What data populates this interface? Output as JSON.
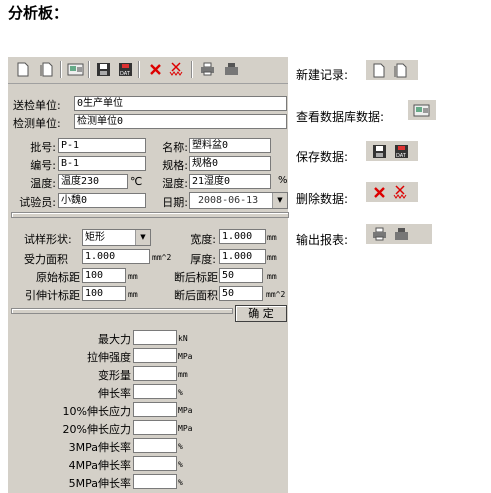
{
  "page_title": "分析板：",
  "top_form": {
    "sender_label": "送检单位:",
    "sender_value": "0生产单位",
    "tester_label": "检测单位:",
    "tester_value": "检测单位0"
  },
  "sample": {
    "batch_label": "批号:",
    "batch_value": "P-1",
    "name_label": "名称:",
    "name_value": "塑料盆0",
    "code_label": "编号:",
    "code_value": "B-1",
    "spec_label": "规格:",
    "spec_value": "规格0",
    "temp_label": "温度:",
    "temp_value": "温度230",
    "temp_unit": "℃",
    "humidity_label": "湿度:",
    "humidity_value": "21湿度0",
    "humidity_unit": "%",
    "operator_label": "试验员:",
    "operator_value": "小魏0",
    "date_label": "日期:",
    "date_value": "2008-06-13"
  },
  "geometry": {
    "shape_label": "试样形状:",
    "shape_value": "矩形",
    "width_label": "宽度:",
    "width_value": "1.000",
    "width_unit": "mm",
    "area_label": "受力面积",
    "area_value": "1.000",
    "area_unit": "mm^2",
    "thickness_label": "厚度:",
    "thickness_value": "1.000",
    "thickness_unit": "mm",
    "orig_gauge_label": "原始标距",
    "orig_gauge_value": "100",
    "orig_gauge_unit": "mm",
    "break_gauge_label": "断后标距",
    "break_gauge_value": "50",
    "break_gauge_unit": "mm",
    "ext_gauge_label": "引伸计标距",
    "ext_gauge_value": "100",
    "ext_gauge_unit": "mm",
    "break_area_label": "断后面积",
    "break_area_value": "50",
    "break_area_unit": "mm^2",
    "ok_label": "确 定"
  },
  "results": [
    {
      "label": "最大力",
      "unit": "kN"
    },
    {
      "label": "拉伸强度",
      "unit": "MPa"
    },
    {
      "label": "变形量",
      "unit": "mm"
    },
    {
      "label": "伸长率",
      "unit": "%"
    },
    {
      "label": "10%伸长应力",
      "unit": "MPa"
    },
    {
      "label": "20%伸长应力",
      "unit": "MPa"
    },
    {
      "label": "3MPa伸长率",
      "unit": "%"
    },
    {
      "label": "4MPa伸长率",
      "unit": "%"
    },
    {
      "label": "5MPa伸长率",
      "unit": "%"
    }
  ],
  "legend": {
    "new_record": "新建记录:",
    "view_db": "查看数据库数据:",
    "save": "保存数据:",
    "delete": "删除数据:",
    "export": "输出报表:"
  },
  "icons": [
    "new-doc-icon",
    "copy-doc-icon",
    "database-icon",
    "save-icon",
    "save-dat-icon",
    "delete-icon",
    "delete-all-icon",
    "print-icon",
    "export-icon"
  ]
}
